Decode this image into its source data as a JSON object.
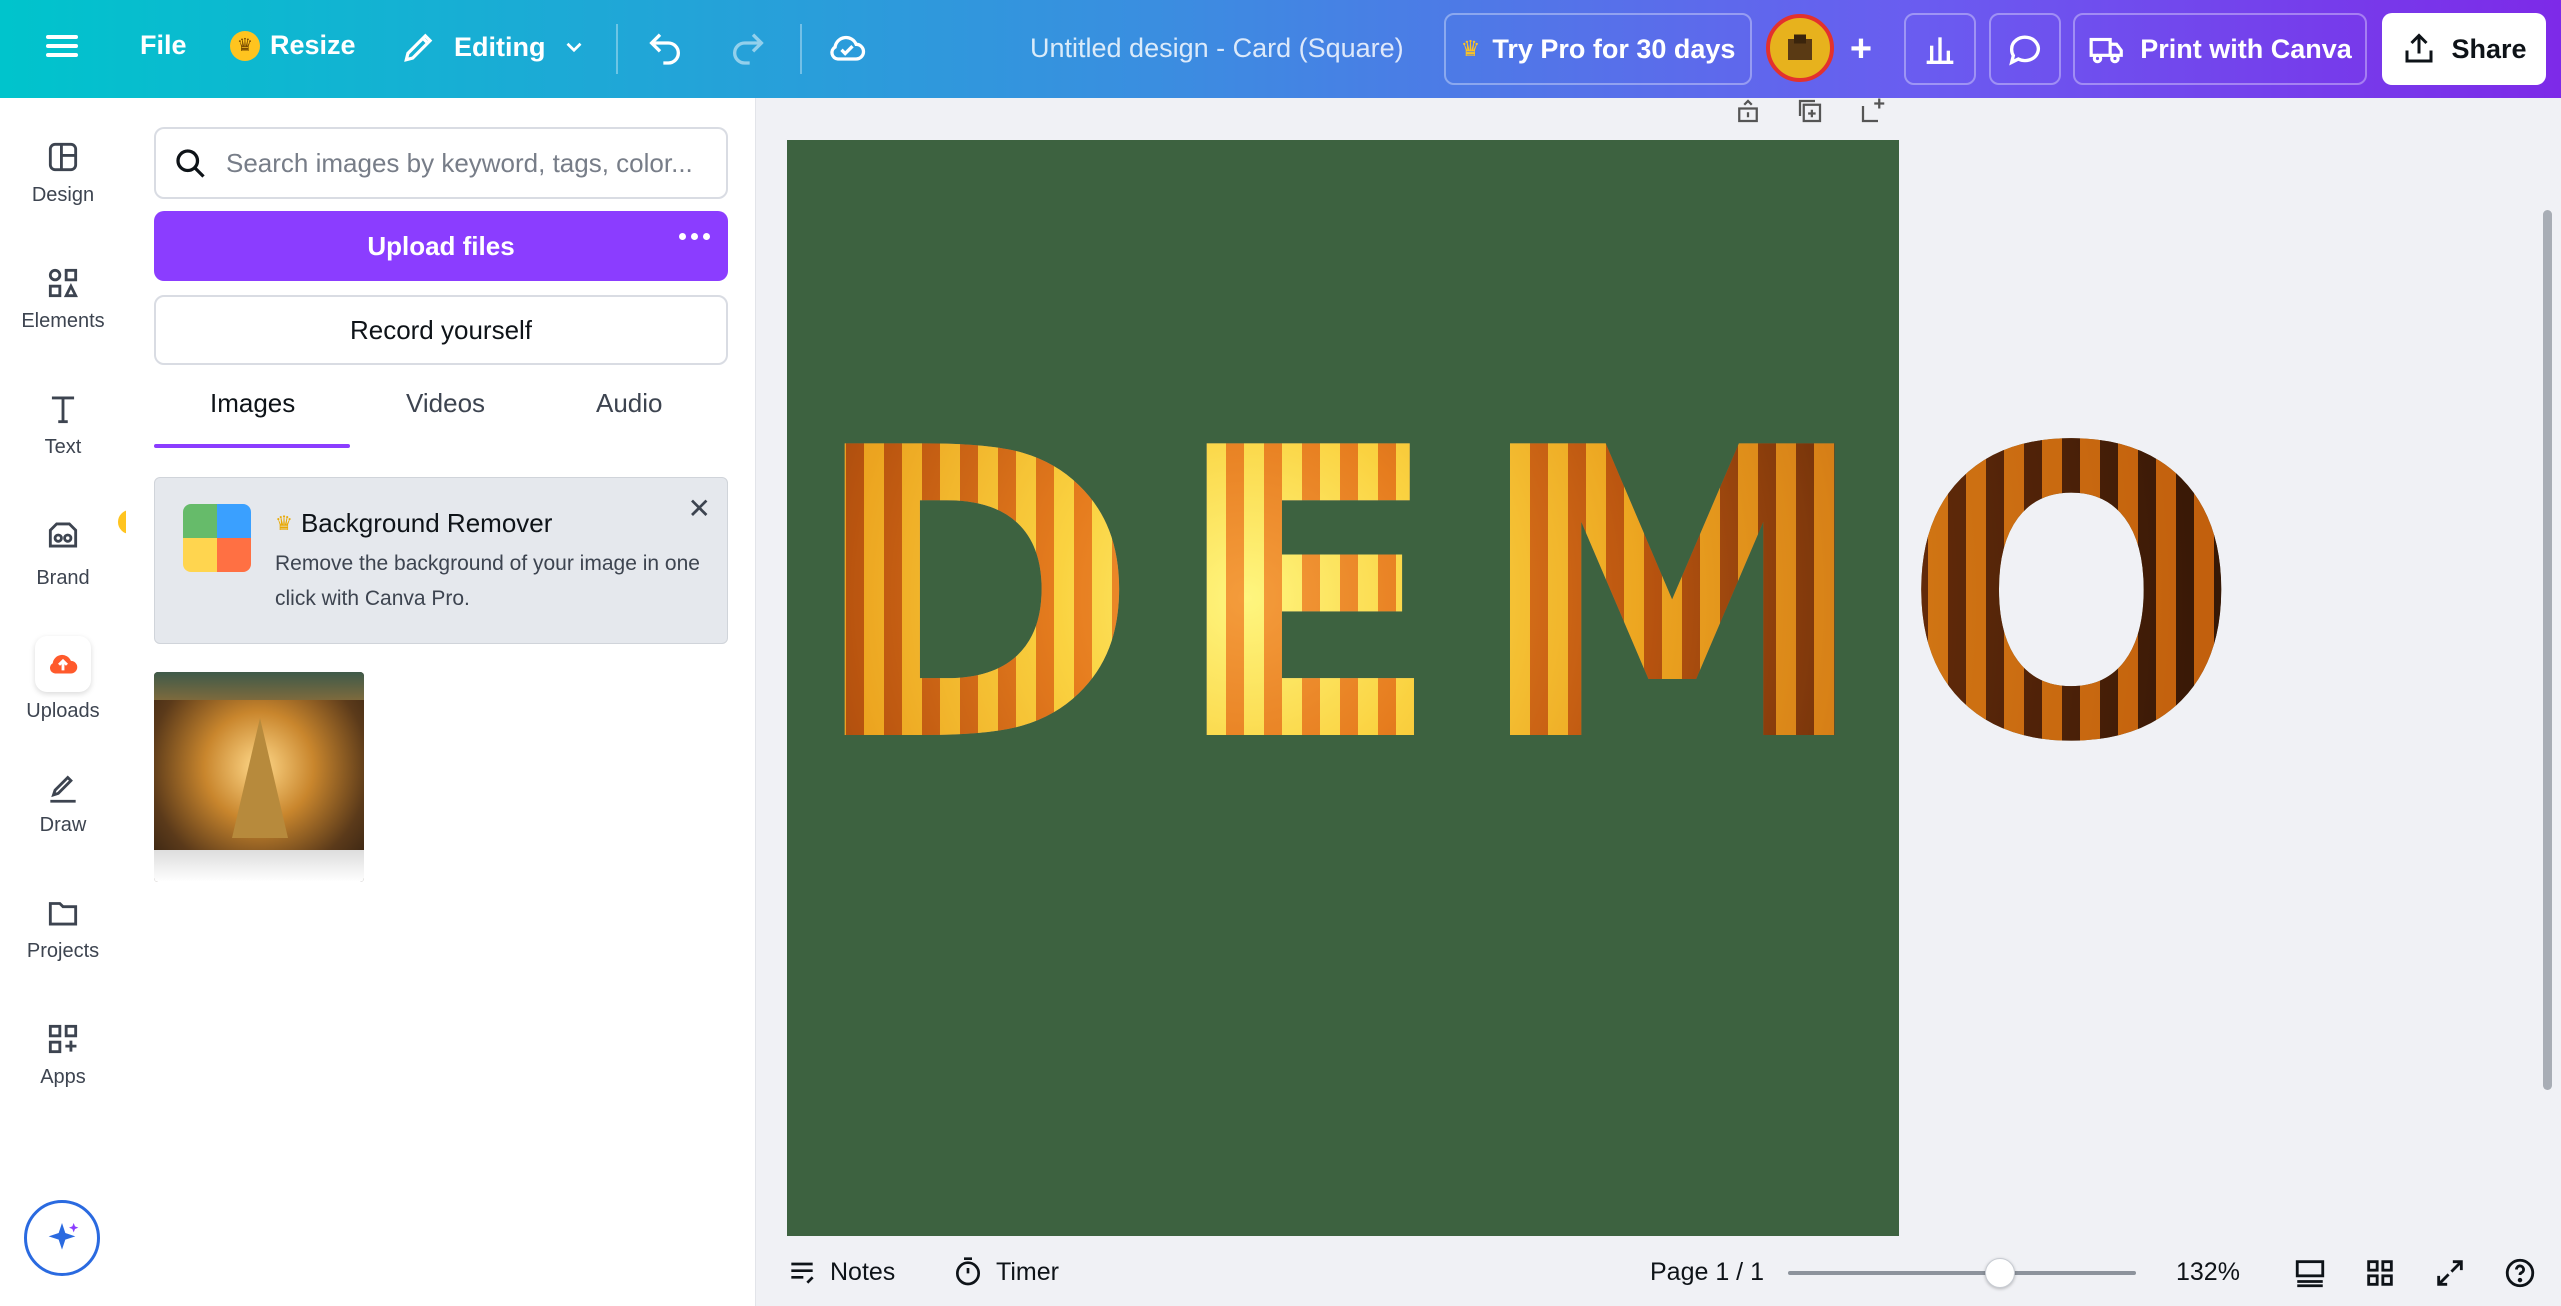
{
  "topbar": {
    "file_label": "File",
    "resize_label": "Resize",
    "editing_label": "Editing",
    "doc_title": "Untitled design - Card (Square)",
    "trypro_label": "Try Pro for 30 days",
    "print_label": "Print with Canva",
    "share_label": "Share"
  },
  "rail": {
    "items": [
      {
        "label": "Design"
      },
      {
        "label": "Elements"
      },
      {
        "label": "Text"
      },
      {
        "label": "Brand"
      },
      {
        "label": "Uploads"
      },
      {
        "label": "Draw"
      },
      {
        "label": "Projects"
      },
      {
        "label": "Apps"
      }
    ]
  },
  "panel": {
    "search_placeholder": "Search images by keyword, tags, color...",
    "upload_label": "Upload files",
    "record_label": "Record yourself",
    "tabs": [
      {
        "label": "Images"
      },
      {
        "label": "Videos"
      },
      {
        "label": "Audio"
      }
    ],
    "promo": {
      "title": "Background Remover",
      "desc": "Remove the background of your image in one click with Canva Pro."
    }
  },
  "canvas": {
    "text": "DEMO",
    "background": "#3d6240"
  },
  "bottombar": {
    "notes_label": "Notes",
    "timer_label": "Timer",
    "page_indicator": "Page 1 / 1",
    "zoom": "132%",
    "zoom_level_fraction": 0.61
  },
  "colors": {
    "accent": "#8b3dff",
    "crown": "#ffc41f"
  }
}
